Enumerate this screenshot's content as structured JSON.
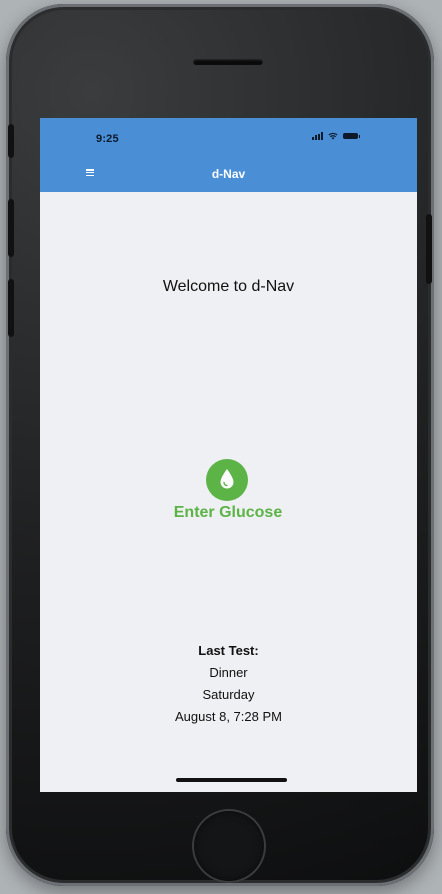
{
  "status_bar": {
    "time": "9:25"
  },
  "header": {
    "title": "d-Nav",
    "menu_icon": "hamburger-menu-icon",
    "color": "#4a8fd6"
  },
  "main": {
    "welcome": "Welcome to d-Nav",
    "enter_glucose": {
      "label": "Enter Glucose",
      "icon": "drop-icon",
      "color": "#5cb346"
    }
  },
  "last_test": {
    "heading": "Last Test:",
    "meal": "Dinner",
    "day": "Saturday",
    "datetime": "August 8, 7:28 PM"
  },
  "colors": {
    "background": "#eff0f4",
    "text": "#111111"
  }
}
